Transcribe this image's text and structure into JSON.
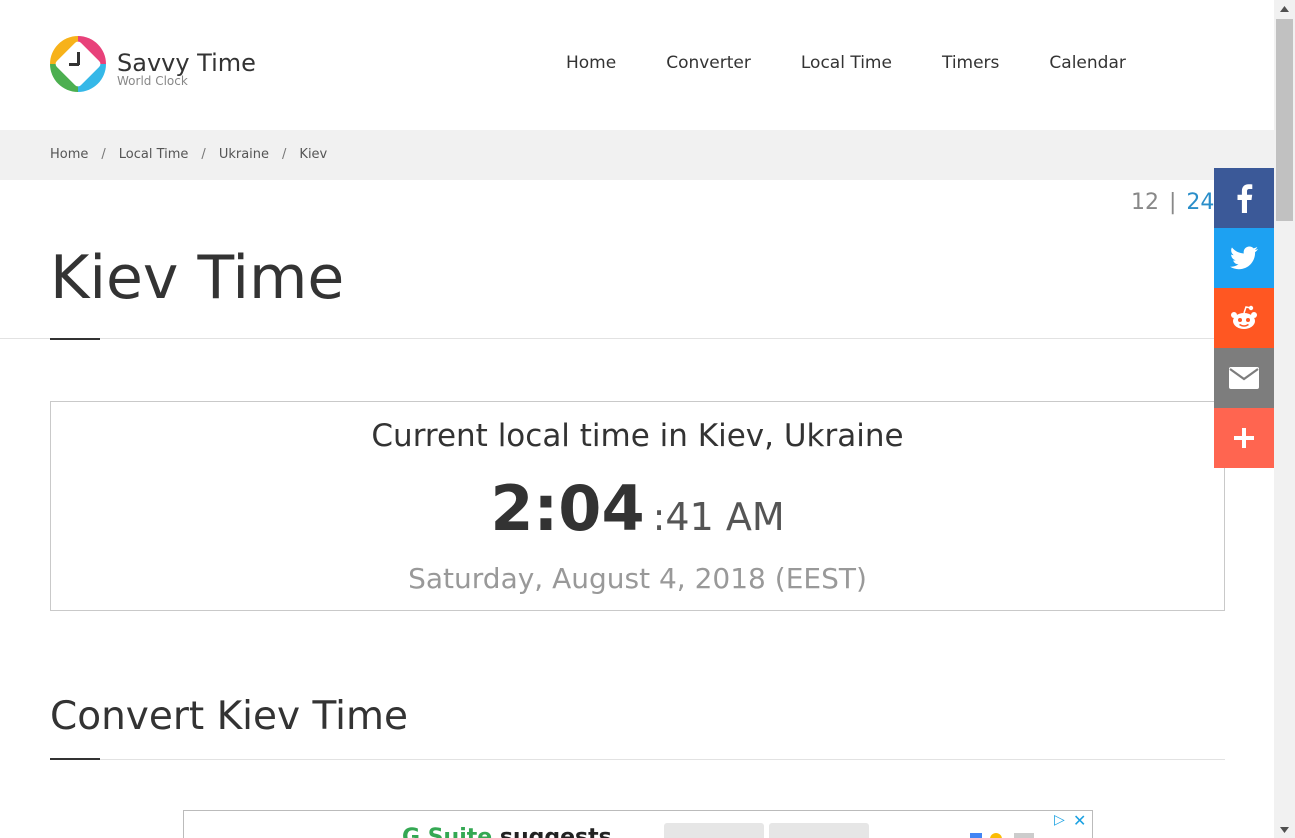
{
  "brand": {
    "name": "Savvy Time",
    "tagline": "World Clock"
  },
  "nav": {
    "items": [
      {
        "label": "Home"
      },
      {
        "label": "Converter"
      },
      {
        "label": "Local Time"
      },
      {
        "label": "Timers"
      },
      {
        "label": "Calendar"
      }
    ]
  },
  "breadcrumb": {
    "items": [
      {
        "label": "Home"
      },
      {
        "label": "Local Time"
      },
      {
        "label": "Ukraine"
      },
      {
        "label": "Kiev"
      }
    ],
    "separator": "/"
  },
  "hour_format": {
    "option_12": "12",
    "separator": "|",
    "option_24": "24",
    "active": "24"
  },
  "page": {
    "title": "Kiev Time"
  },
  "clock": {
    "heading": "Current local time in Kiev, Ukraine",
    "hours_minutes": "2:04",
    "seconds_ampm": ":41 AM",
    "date": "Saturday, August 4, 2018 (EEST)"
  },
  "convert": {
    "title": "Convert Kiev Time"
  },
  "ad": {
    "text_brand": "G Suite",
    "text_rest": " suggests"
  },
  "share": {
    "buttons": [
      {
        "icon": "facebook-icon",
        "color": "#3b5998"
      },
      {
        "icon": "twitter-icon",
        "color": "#1da1f2"
      },
      {
        "icon": "reddit-icon",
        "color": "#ff5722"
      },
      {
        "icon": "email-icon",
        "color": "#7d7d7d"
      },
      {
        "icon": "plus-icon",
        "color": "#ff6550"
      }
    ]
  },
  "colors": {
    "accent": "#2a8ec9",
    "breadcrumb_bg": "#f1f1f1"
  }
}
